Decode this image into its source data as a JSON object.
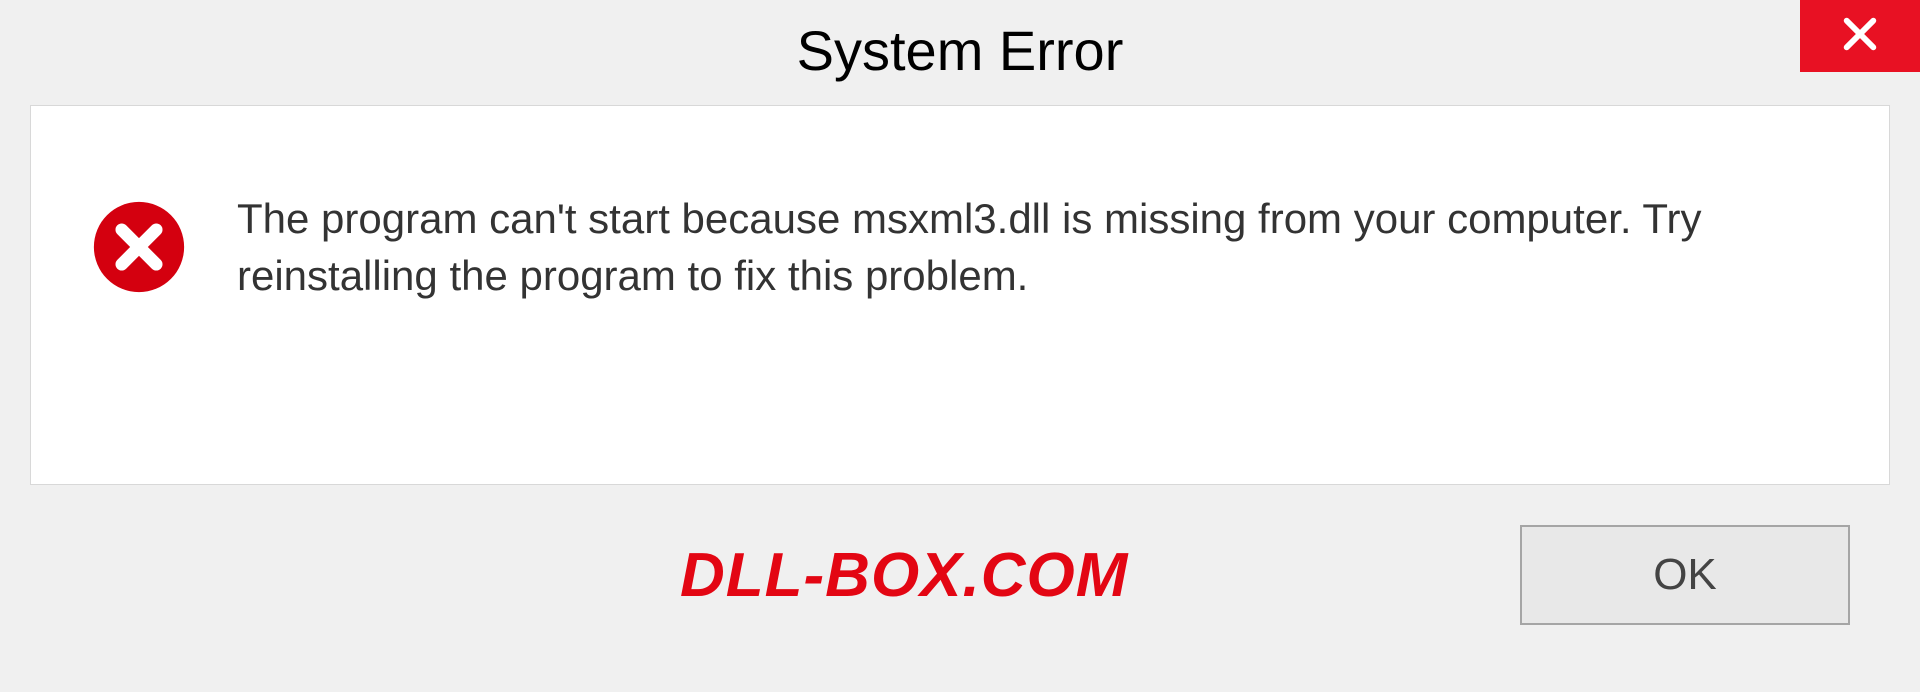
{
  "title": "System Error",
  "message": "The program can't start because msxml3.dll is missing from your computer. Try reinstalling the program to fix this problem.",
  "ok_label": "OK",
  "watermark": "DLL-BOX.COM",
  "colors": {
    "close_bg": "#e81123",
    "error_icon": "#d4000f",
    "watermark_text": "#e30613"
  }
}
